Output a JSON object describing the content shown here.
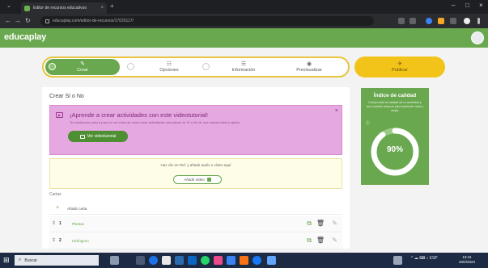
{
  "browser": {
    "tab_title": "Editor de recursos educativos",
    "tab_close": "×",
    "tab_new": "+",
    "tab_menu": "⌄",
    "url": "educaplay.com/editor-de-recursos/17025117/",
    "window_controls": [
      "–",
      "□",
      "×"
    ]
  },
  "app": {
    "logo": "educaplay"
  },
  "steps": [
    {
      "label": "Crear",
      "icon": "✎"
    },
    {
      "label": "Opciones",
      "icon": "☷"
    },
    {
      "label": "Información",
      "icon": "☰"
    },
    {
      "label": "Previsualizar",
      "icon": "◉"
    }
  ],
  "publish": {
    "label": "Publicar",
    "icon": "✈"
  },
  "main": {
    "title": "Crear Sí o No",
    "tutorial": {
      "title": "¡Aprende a crear actividades con este videotutorial!",
      "subtitle": "Te mostramos paso a paso en un vídeo de cómo crear actividades educativas de Sí o No de una manera fácil y rápida.",
      "button": "Ver videotutorial",
      "close": "×"
    },
    "media": {
      "text": "Haz clic en Ref. y añade audio o vídeo aquí",
      "button": "Añadir vídeo"
    },
    "section_label": "Cartas",
    "add_label": "Añadir carta",
    "questions": [
      {
        "num": "1",
        "text": "Plantas"
      },
      {
        "num": "2",
        "text": "Hidrógeno"
      }
    ]
  },
  "quality": {
    "title": "Índice de calidad",
    "description": "Comprueba la calidad de tu actividad y qué puedes mejorar para aprender más y mejor.",
    "info": "ⓘ",
    "value": "90%",
    "progress": 0.9
  },
  "taskbar": {
    "search": "Buscar",
    "tray": "^ ☁ ⌨ ♪ ESP",
    "time": "13:41",
    "date": "20/2/2024"
  },
  "colors": {
    "brand_green": "#6aa84f",
    "publish_yellow": "#f2c318",
    "tutorial_pink": "#e6a8e0"
  }
}
